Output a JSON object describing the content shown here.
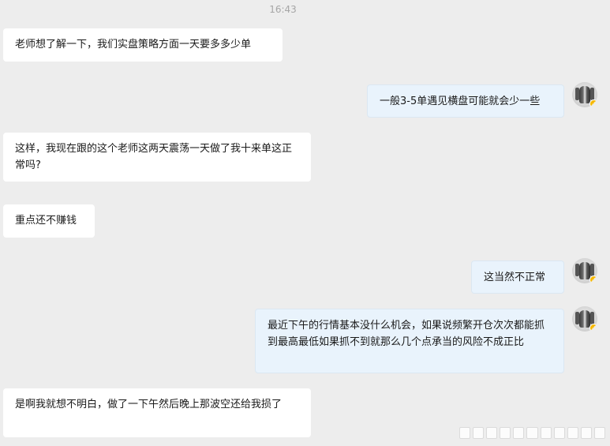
{
  "timestamp": "16:43",
  "messages": [
    {
      "side": "left",
      "text": "老师想了解一下，我们实盘策略方面一天要多多少单"
    },
    {
      "side": "right",
      "text": "一般3-5单遇见横盘可能就会少一些"
    },
    {
      "side": "left",
      "text": "这样，我现在跟的这个老师这两天震荡一天做了我十来单这正常吗?"
    },
    {
      "side": "left",
      "text": "重点还不赚钱"
    },
    {
      "side": "right",
      "text": "这当然不正常"
    },
    {
      "side": "right",
      "text": "最近下午的行情基本没什么机会，如果说频繁开仓次次都能抓到最高最低如果抓不到就那么几个点承当的风险不成正比"
    },
    {
      "side": "left",
      "text": "是啊我就想不明白，做了一下午然后晚上那波空还给我损了"
    }
  ],
  "icons": {
    "avatar": "user-avatar-icon",
    "badge": "verified-badge-icon"
  },
  "colors": {
    "background": "#ededed",
    "left_bubble": "#ffffff",
    "right_bubble": "#e9f3fc",
    "badge": "#f5b700"
  }
}
